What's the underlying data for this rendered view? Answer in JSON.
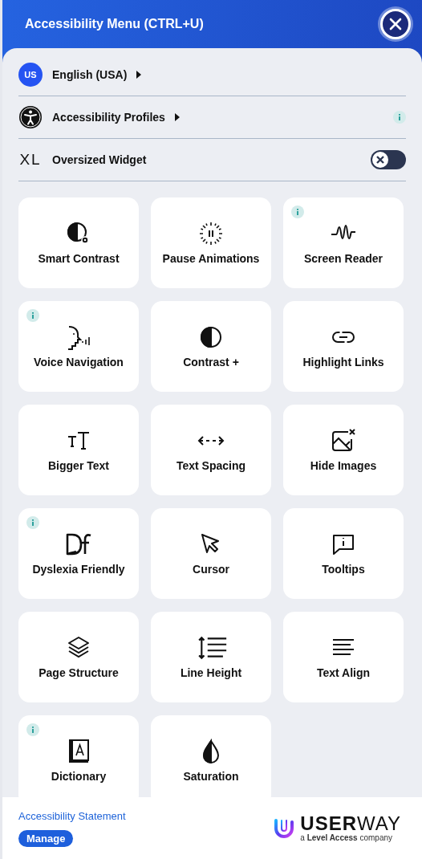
{
  "header": {
    "title": "Accessibility Menu (CTRL+U)"
  },
  "settings": [
    {
      "kind": "language",
      "badge": "US",
      "label": "English (USA)",
      "info": false
    },
    {
      "kind": "profiles",
      "label": "Accessibility Profiles",
      "info": true
    },
    {
      "kind": "toggle",
      "badge": "XL",
      "label": "Oversized Widget",
      "on": false
    }
  ],
  "features": [
    {
      "kind": "smart-contrast",
      "label": "Smart Contrast",
      "info": false
    },
    {
      "kind": "pause",
      "label": "Pause Animations",
      "info": false
    },
    {
      "kind": "wave",
      "label": "Screen Reader",
      "info": true
    },
    {
      "kind": "voice",
      "label": "Voice Navigation",
      "info": true
    },
    {
      "kind": "contrast",
      "label": "Contrast +",
      "info": false
    },
    {
      "kind": "link",
      "label": "Highlight Links",
      "info": false
    },
    {
      "kind": "text-size",
      "label": "Bigger Text",
      "info": false
    },
    {
      "kind": "spacing",
      "label": "Text Spacing",
      "info": false
    },
    {
      "kind": "hide-image",
      "label": "Hide Images",
      "info": false
    },
    {
      "kind": "dyslexia",
      "label": "Dyslexia Friendly",
      "info": true
    },
    {
      "kind": "cursor",
      "label": "Cursor",
      "info": false
    },
    {
      "kind": "tooltip",
      "label": "Tooltips",
      "info": false
    },
    {
      "kind": "layers",
      "label": "Page Structure",
      "info": false
    },
    {
      "kind": "line-height",
      "label": "Line Height",
      "info": false
    },
    {
      "kind": "align",
      "label": "Text Align",
      "info": false
    },
    {
      "kind": "book",
      "label": "Dictionary",
      "info": true
    },
    {
      "kind": "drop",
      "label": "Saturation",
      "info": false
    }
  ],
  "footer": {
    "link": "Accessibility Statement",
    "button": "Manage",
    "logo": "**USER**WAY",
    "tagline": "a **Level Access** company"
  }
}
